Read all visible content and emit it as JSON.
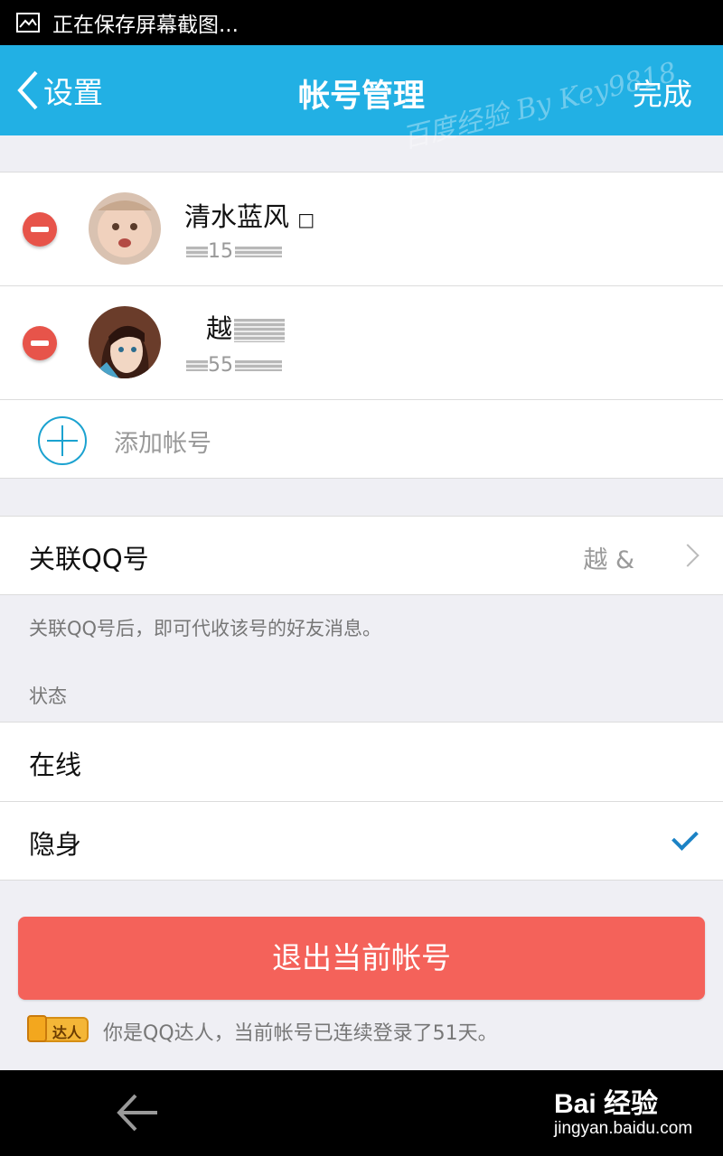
{
  "status_bar": {
    "text": "正在保存屏幕截图..."
  },
  "header": {
    "back_label": "设置",
    "title": "帐号管理",
    "done_label": "完成",
    "watermark": "百度经验 By Key9818"
  },
  "accounts": [
    {
      "name": "清水蓝风",
      "name_suffix": "□",
      "number": "15"
    },
    {
      "name": "越",
      "name_suffix": "",
      "number": "55"
    }
  ],
  "add_account_label": "添加帐号",
  "linked_qq": {
    "label": "关联QQ号",
    "value": "越 &",
    "hint": "关联QQ号后，即可代收该号的好友消息。"
  },
  "status_section": {
    "header": "状态",
    "options": [
      {
        "label": "在线",
        "selected": false
      },
      {
        "label": "隐身",
        "selected": true
      }
    ]
  },
  "logout_label": "退出当前帐号",
  "talent": {
    "badge": "达人",
    "text": "你是QQ达人，当前帐号已连续登录了51天。"
  },
  "footer": {
    "logo": "Bai 经验",
    "url": "jingyan.baidu.com"
  },
  "colors": {
    "header_blue": "#22b0e4",
    "logout_red": "#f4625a",
    "remove_red": "#e7544a",
    "check_blue": "#1b82c5"
  }
}
